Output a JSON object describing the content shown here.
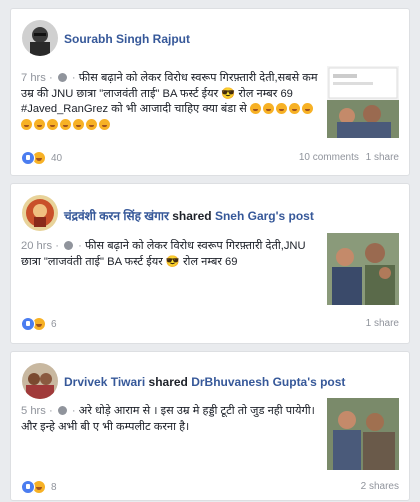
{
  "posts": [
    {
      "author": "Sourabh Singh Rajput",
      "shared_text": "",
      "shared_target": "",
      "time": "7 hrs",
      "text": "फीस बढ़ाने को लेकर विरोध स्वरूप गिरफ़्तारी देती,सबसे कम उम्र की JNU छात्रा \"लाजवंती ताई\" BA फर्स्ट ईयर 😎 रोल नम्बर 69 #Javed_RanGrez को भी आजादी चाहिए क्या बंडा से",
      "reaction_count": "40",
      "comments": "10 comments",
      "shares": "1 share"
    },
    {
      "author": "चंद्रवंशी करन सिंह खंगार",
      "shared_text": "shared",
      "shared_target": "Sneh Garg's post",
      "time": "20 hrs",
      "text": "फीस बढ़ाने को लेकर विरोध स्वरूप गिरफ़्तारी देती,JNU छात्रा \"लाजवंती ताई\" BA फर्स्ट ईयर 😎 रोल नम्बर 69",
      "reaction_count": "6",
      "comments": "",
      "shares": "1 share"
    },
    {
      "author": "Drvivek Tiwari",
      "shared_text": "shared",
      "shared_target": "DrBhuvanesh Gupta's post",
      "time": "5 hrs",
      "text": "अरे धोड़े आराम से । इस उम्र मे हड्डी टूटी तो जुड नही पायेगी। और इन्हे अभी बी ए भी कम्पलीट करना है।",
      "reaction_count": "8",
      "comments": "",
      "shares": "2 shares"
    }
  ]
}
